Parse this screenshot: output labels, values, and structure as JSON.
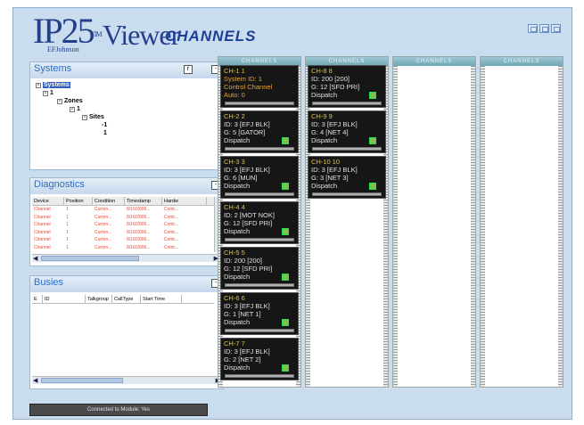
{
  "header": {
    "logo_ip": "IP25",
    "logo_tm": "TM",
    "logo_viewer": "Viewer",
    "logo_brand": "EFJohnson",
    "title": "CHANNELS"
  },
  "systems": {
    "title": "Systems",
    "pin_button": "r",
    "collapse_button": "-",
    "tree": [
      {
        "label": "Systems",
        "expander": "-"
      },
      {
        "label": "1",
        "expander": "-"
      },
      {
        "label": "Zones",
        "expander": "-"
      },
      {
        "label": "1",
        "expander": "-"
      },
      {
        "label": "Sites",
        "expander": "-"
      },
      {
        "label": "-1",
        "expander": ""
      },
      {
        "label": "1",
        "expander": ""
      }
    ]
  },
  "diagnostics": {
    "title": "Diagnostics",
    "collapse_button": "-",
    "columns": [
      "Device",
      "Position",
      "Condition",
      "Timestamp",
      "Hardw"
    ],
    "rows": [
      [
        "Channel",
        "1",
        "Curren...",
        "8/16/2006...",
        "Contr..."
      ],
      [
        "Channel",
        "1",
        "Curren...",
        "8/16/2006...",
        "Contr..."
      ],
      [
        "Channel",
        "1",
        "Curren...",
        "8/16/2006...",
        "Contr..."
      ],
      [
        "Channel",
        "1",
        "Curren...",
        "8/16/2006...",
        "Contr..."
      ],
      [
        "Channel",
        "1",
        "Curren...",
        "8/16/2006...",
        "Contr..."
      ],
      [
        "Channel",
        "1",
        "Curren...",
        "8/16/2006...",
        "Contr..."
      ]
    ]
  },
  "busies": {
    "title": "Busies",
    "collapse_button": "-",
    "columns": [
      "E",
      "ID",
      "Talkgroup",
      "CallType",
      "Start Time"
    ]
  },
  "status": {
    "text": "Connected to Module: Yes"
  },
  "column_header": "CHANNELS",
  "channels": [
    {
      "col": 0,
      "l1": "CH-1   1",
      "l2": "System ID: 1",
      "l3": "Control Channel",
      "l4": "Auto: 0",
      "control": true
    },
    {
      "col": 0,
      "l1": "CH-2   2",
      "l2": "ID: 3 [EFJ BLK]",
      "l3": "G: 5 [GATOR]",
      "l4": "Dispatch",
      "control": false
    },
    {
      "col": 0,
      "l1": "CH-3   3",
      "l2": "ID: 3 [EFJ BLK]",
      "l3": "G: 6 [MUN]",
      "l4": "Dispatch",
      "control": false
    },
    {
      "col": 0,
      "l1": "CH-4   4",
      "l2": "ID: 2 [MOT NOK]",
      "l3": "G: 12 [SFD PRI]",
      "l4": "Dispatch",
      "control": false
    },
    {
      "col": 0,
      "l1": "CH-5   5",
      "l2": "ID: 200 [200]",
      "l3": "G: 12 [SFD PRI]",
      "l4": "Dispatch",
      "control": false
    },
    {
      "col": 0,
      "l1": "CH-6   6",
      "l2": "ID: 3 [EFJ BLK]",
      "l3": "G: 1 [NET 1]",
      "l4": "Dispatch",
      "control": false
    },
    {
      "col": 0,
      "l1": "CH-7   7",
      "l2": "ID: 3 [EFJ BLK]",
      "l3": "G: 2 [NET 2]",
      "l4": "Dispatch",
      "control": false
    },
    {
      "col": 1,
      "l1": "CH-8   8",
      "l2": "ID: 200 [200]",
      "l3": "G: 12 [SFD PRI]",
      "l4": "Dispatch",
      "control": false
    },
    {
      "col": 1,
      "l1": "CH-9   9",
      "l2": "ID: 3 [EFJ BLK]",
      "l3": "G: 4 [NET 4]",
      "l4": "Dispatch",
      "control": false
    },
    {
      "col": 1,
      "l1": "CH-10  10",
      "l2": "ID: 3 [EFJ BLK]",
      "l3": "G: 3 [NET 3]",
      "l4": "Dispatch",
      "control": false
    }
  ],
  "colors": {
    "accent": "#2d6cc6",
    "channel_bg": "#161616",
    "channel_title": "#e0c040",
    "control_text": "#e0a33a",
    "led_green": "#7cc24b",
    "diag_text": "#e64a3a"
  }
}
